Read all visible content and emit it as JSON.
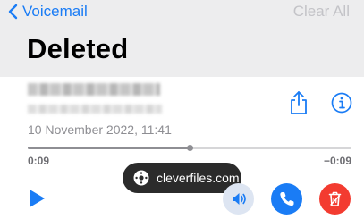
{
  "header": {
    "back_label": "Voicemail",
    "clear_all_label": "Clear All",
    "title": "Deleted"
  },
  "message": {
    "date": "10 November 2022, 11:41"
  },
  "playback": {
    "elapsed": "0:09",
    "remaining": "−0:09",
    "progress": 0.5
  },
  "watermark": {
    "text": "cleverfiles.com"
  },
  "colors": {
    "accent": "#1a7cf5",
    "danger": "#f33b30",
    "header_bg": "#ededee"
  },
  "icons": {
    "back": "chevron-left-icon",
    "share": "share-icon",
    "info": "info-icon",
    "play": "play-icon",
    "speaker": "speaker-icon",
    "call": "phone-icon",
    "delete": "trash-icon"
  }
}
